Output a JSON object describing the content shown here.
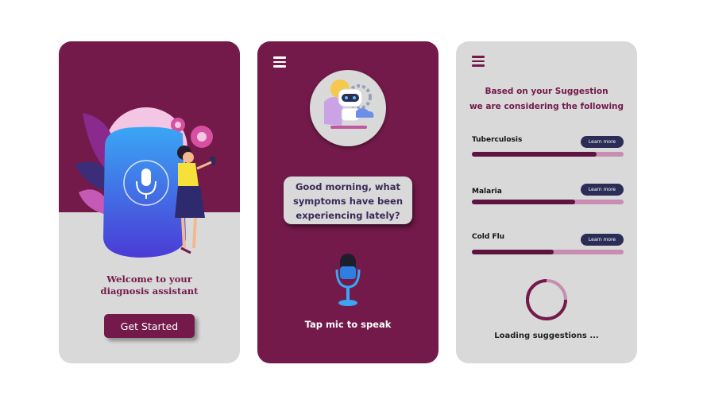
{
  "colors": {
    "primary": "#731a4b",
    "panel": "#d9d9d9",
    "navy": "#2b2d57",
    "bar_track": "#c88db2",
    "bar_fill": "#5e1340"
  },
  "screen1": {
    "welcome_line1": "Welcome to your",
    "welcome_line2": "diagnosis assistant",
    "cta_label": "Get Started"
  },
  "screen2": {
    "menu_icon": "hamburger-menu-icon",
    "bot_icon": "robot-assistant-icon",
    "message_line1": "Good morning, what",
    "message_line2": "symptoms have been",
    "message_line3": "experiencing lately?",
    "mic_icon": "microphone-icon",
    "mic_prompt": "Tap mic to speak"
  },
  "screen3": {
    "menu_icon": "hamburger-menu-icon",
    "heading_line1": "Based on your Suggestion",
    "heading_line2": "we are considering the following",
    "conditions": [
      {
        "name": "Tuberculosis",
        "button": "Learn more",
        "progress": 0.82
      },
      {
        "name": "Malaria",
        "button": "Learn more",
        "progress": 0.68
      },
      {
        "name": "Cold Flu",
        "button": "Learn more",
        "progress": 0.54
      }
    ],
    "loading_text": "Loading suggestions ..."
  }
}
